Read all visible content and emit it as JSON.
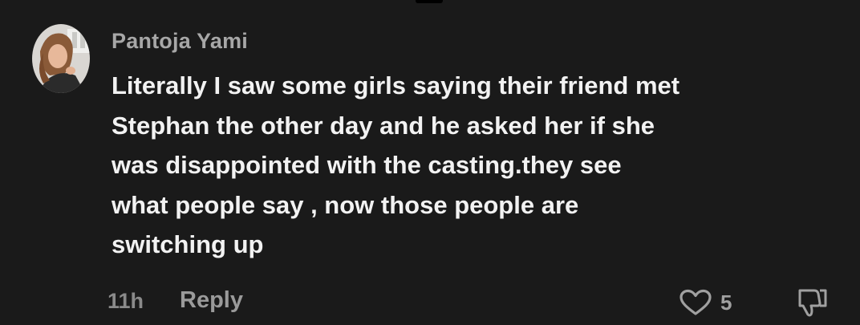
{
  "comment": {
    "author": "Pantoja Yami",
    "text": "Literally I saw some girls saying their friend met\nStephan the other day and he asked her if she\nwas disappointed with the casting.they see\nwhat people say , now those people are\nswitching up",
    "timestamp": "11h",
    "reply_label": "Reply",
    "like_count": "5",
    "icons": {
      "like": "heart-outline-icon",
      "dislike": "thumbs-down-outline-icon"
    }
  },
  "colors": {
    "background": "#1a1a1a",
    "text": "#f2f2f2",
    "muted": "#a7a7a7"
  }
}
